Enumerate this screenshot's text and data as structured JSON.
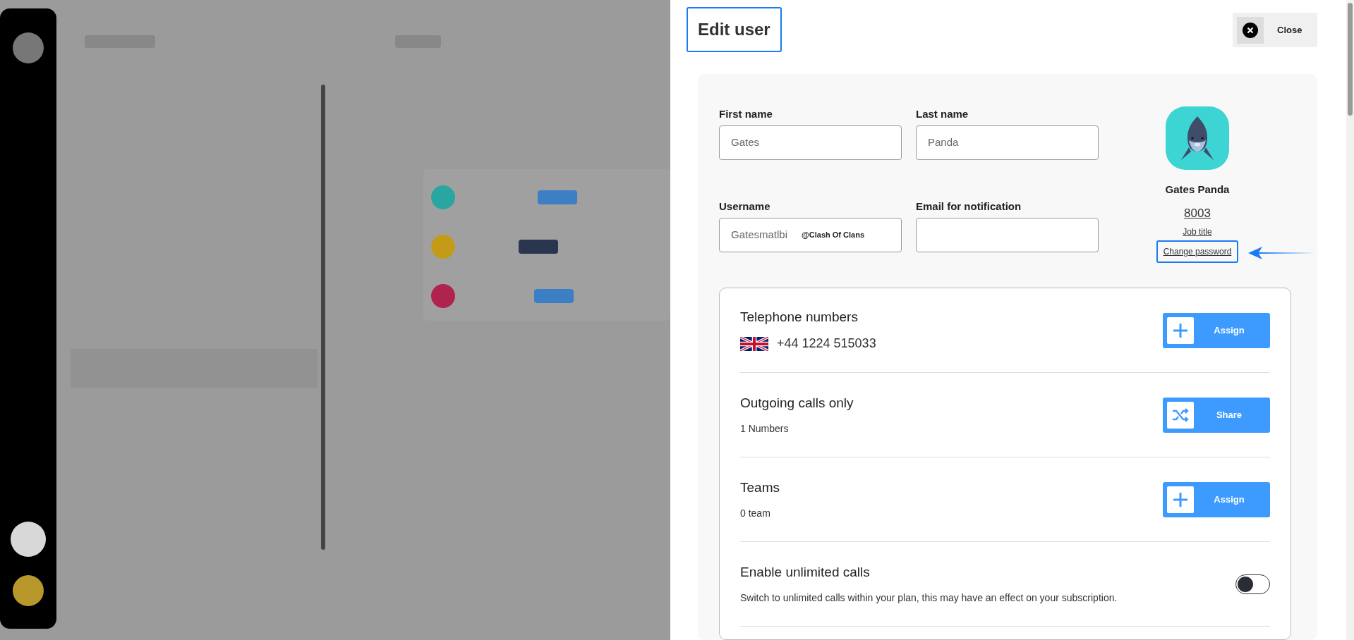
{
  "dialog": {
    "title": "Edit user",
    "close_button": "Close"
  },
  "form": {
    "fields": [
      {
        "label": "First name",
        "value": "Gates"
      },
      {
        "label": "Last name",
        "value": "Panda"
      },
      {
        "label": "Username",
        "value": "Gatesmatlbi",
        "suffix": "@Clash Of Clans"
      },
      {
        "label": "Email for notification"
      }
    ]
  },
  "profile": {
    "name": "Gates Panda",
    "extension": "8003",
    "job_title_link": "Job title",
    "change_password_link": "Change password",
    "highlighted": true
  },
  "sections": [
    {
      "kind": "button",
      "title": "Telephone numbers",
      "numbers": [
        {
          "text": "+44 1224 515033"
        }
      ],
      "button": {
        "kind": "assign",
        "label": "Assign"
      }
    },
    {
      "kind": "button",
      "title": "Outgoing calls only",
      "subtitle": "1 Numbers",
      "button": {
        "kind": "share",
        "label": "Share"
      }
    },
    {
      "kind": "button",
      "title": "Teams",
      "subtitle": "0 team",
      "button": {
        "kind": "assign",
        "label": "Assign"
      }
    },
    {
      "kind": "toggle",
      "title": "Enable unlimited calls",
      "subtitle": "Switch to unlimited calls within your plan, this may have an effect on your subscription.",
      "on": false
    }
  ]
}
